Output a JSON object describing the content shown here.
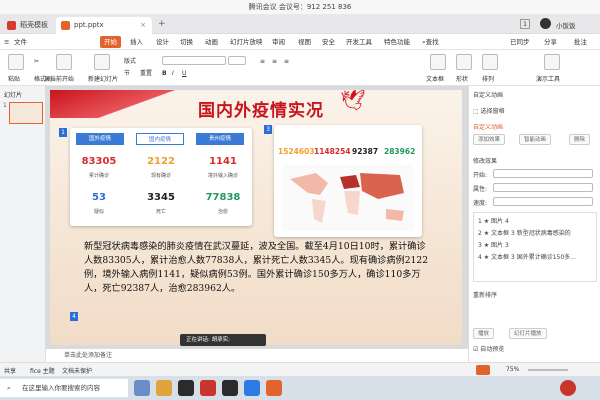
{
  "meeting_bar": {
    "title": "腾讯会议 会议号：912 251 836"
  },
  "tabs": [
    {
      "label": "稻壳模板",
      "color": "#d83b2d"
    },
    {
      "label": "ppt.pptx",
      "color": "#e3632d"
    }
  ],
  "window_extras": {
    "page_badge": "1",
    "user_name": "小饭饭"
  },
  "menu": [
    "文件",
    "开始",
    "插入",
    "设计",
    "切换",
    "动画",
    "幻灯片放映",
    "审阅",
    "视图",
    "安全",
    "开发工具",
    "特色功能"
  ],
  "menu_search": "查找",
  "menu_right": {
    "sync": "已同步",
    "share": "分享",
    "batch": "批注"
  },
  "ribbon": {
    "paste": "粘贴",
    "format_painter": "格式刷",
    "from_start": "从当前开始",
    "new_slide": "新建幻灯片",
    "layout": "版式",
    "section": "节",
    "reset": "重置",
    "textbox": "文本框",
    "shape": "形状",
    "arrange": "排列",
    "presenter": "演示工具"
  },
  "left_pane": {
    "header": "幻灯片",
    "slide_num": "1"
  },
  "slide": {
    "title": "国内外疫情实况",
    "card1": {
      "num": "1",
      "tabs": [
        "国外疫情",
        "国内疫情",
        "贵州疫情"
      ],
      "stats": [
        {
          "value": "83305",
          "label": "累计确诊",
          "color": "#d92b2b"
        },
        {
          "value": "2122",
          "label": "现有确诊",
          "color": "#f0a02b"
        },
        {
          "value": "1141",
          "label": "境外输入确诊",
          "color": "#d92b2b"
        },
        {
          "value": "53",
          "label": "疑似",
          "color": "#2b6fd6"
        },
        {
          "value": "3345",
          "label": "死亡",
          "color": "#222222"
        },
        {
          "value": "77838",
          "label": "治愈",
          "color": "#1f9a5c"
        }
      ]
    },
    "card2": {
      "num": "3",
      "stats": [
        {
          "value": "1524603",
          "color": "#f0a02b"
        },
        {
          "value": "1148254",
          "color": "#d92b2b"
        },
        {
          "value": "92387",
          "color": "#222222"
        },
        {
          "value": "283962",
          "color": "#1f9a5c"
        }
      ]
    },
    "left_marker": "4",
    "paragraph": "新型冠状病毒感染的肺炎疫情在武汉蔓延，波及全国。截至4月10日10时，累计确诊人数83305人，累计治愈人数77838人，累计死亡人数3345人。现有确诊病例2122例，境外输入病例1141，疑似病例53例。国外累计确诊150多万人，确诊110多万人，死亡92387人，治愈283962人。"
  },
  "notes_placeholder": "单击此处添加备注",
  "speaking": "正在讲话: 胡承实;",
  "status": {
    "lang": "共享",
    "office": "fice 主题",
    "protect": "文档未保护",
    "zoom": "75%"
  },
  "taskbar": {
    "search_placeholder": "在这里输入你要搜索的内容"
  },
  "right_pane": {
    "title": "自定义动画",
    "select_pane": "选择窗格",
    "custom_anim": "自定义动画",
    "add_effect": "添加效果",
    "smart_anim": "智能动画",
    "delete": "删除",
    "modify": "修改效果",
    "start": "开始:",
    "property": "属性:",
    "speed": "速度:",
    "items": [
      {
        "n": "1",
        "label": "图片 4",
        "extra": ""
      },
      {
        "n": "2",
        "label": "文本框 3",
        "extra": "新型冠状病毒感染的"
      },
      {
        "n": "3",
        "label": "图片 3",
        "extra": ""
      },
      {
        "n": "4",
        "label": "文本框 3",
        "extra": "国外累计确诊150多..."
      }
    ],
    "reorder": "重新排序",
    "play": "播放",
    "slideshow": "幻灯片播放",
    "autopreview": "自动预览"
  }
}
